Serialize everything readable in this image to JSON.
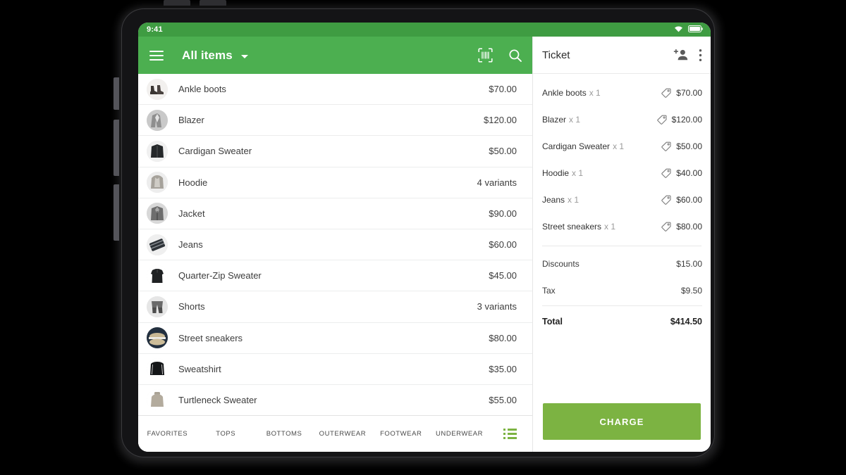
{
  "status_bar": {
    "time": "9:41",
    "wifi_icon": "wifi-icon",
    "battery_icon": "battery-icon"
  },
  "catalog": {
    "menu_icon": "hamburger-menu-icon",
    "title": "All items",
    "dropdown_icon": "chevron-down-icon",
    "scan_icon": "barcode-scan-icon",
    "search_icon": "search-icon",
    "items": [
      {
        "name": "Ankle boots",
        "value": "$70.00",
        "thumb": "ankle-boots"
      },
      {
        "name": "Blazer",
        "value": "$120.00",
        "thumb": "blazer"
      },
      {
        "name": "Cardigan Sweater",
        "value": "$50.00",
        "thumb": "cardigan-sweater"
      },
      {
        "name": "Hoodie",
        "value": "4 variants",
        "thumb": "hoodie"
      },
      {
        "name": "Jacket",
        "value": "$90.00",
        "thumb": "jacket"
      },
      {
        "name": "Jeans",
        "value": "$60.00",
        "thumb": "jeans"
      },
      {
        "name": "Quarter-Zip Sweater",
        "value": "$45.00",
        "thumb": "quarter-zip-sweater"
      },
      {
        "name": "Shorts",
        "value": "3 variants",
        "thumb": "shorts"
      },
      {
        "name": "Street sneakers",
        "value": "$80.00",
        "thumb": "street-sneakers"
      },
      {
        "name": "Sweatshirt",
        "value": "$35.00",
        "thumb": "sweatshirt"
      },
      {
        "name": "Turtleneck Sweater",
        "value": "$55.00",
        "thumb": "turtleneck-sweater"
      }
    ],
    "tabs": [
      {
        "label": "FAVORITES"
      },
      {
        "label": "TOPS"
      },
      {
        "label": "BOTTOMS"
      },
      {
        "label": "OUTERWEAR"
      },
      {
        "label": "FOOTWEAR"
      },
      {
        "label": "UNDERWEAR"
      }
    ],
    "tab_list_icon": "list-view-icon"
  },
  "ticket": {
    "title": "Ticket",
    "add_customer_icon": "add-person-icon",
    "overflow_icon": "more-vertical-icon",
    "line_items": [
      {
        "name": "Ankle boots",
        "qty": "x 1",
        "price": "$70.00",
        "tag_icon": "price-tag-icon"
      },
      {
        "name": "Blazer",
        "qty": "x 1",
        "price": "$120.00",
        "tag_icon": "price-tag-icon"
      },
      {
        "name": "Cardigan Sweater",
        "qty": "x 1",
        "price": "$50.00",
        "tag_icon": "price-tag-icon"
      },
      {
        "name": "Hoodie",
        "qty": "x 1",
        "price": "$40.00",
        "tag_icon": "price-tag-icon"
      },
      {
        "name": "Jeans",
        "qty": "x 1",
        "price": "$60.00",
        "tag_icon": "price-tag-icon"
      },
      {
        "name": "Street sneakers",
        "qty": "x 1",
        "price": "$80.00",
        "tag_icon": "price-tag-icon"
      }
    ],
    "totals": [
      {
        "label": "Discounts",
        "value": "$15.00"
      },
      {
        "label": "Tax",
        "value": "$9.50"
      }
    ],
    "grand_total": {
      "label": "Total",
      "value": "$414.50"
    },
    "charge_label": "CHARGE"
  },
  "colors": {
    "app_bar_green": "#4caf50",
    "status_bar_green": "#3f9c42",
    "charge_green": "#7cb342",
    "device_body": "#141416"
  }
}
